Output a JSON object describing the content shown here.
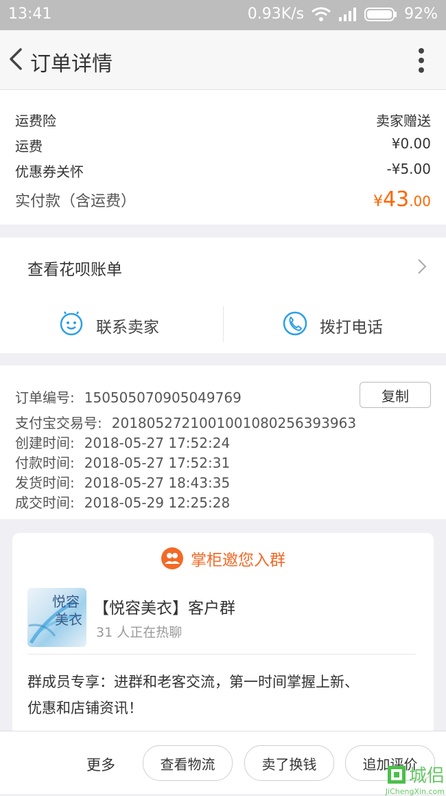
{
  "status": {
    "time": "13:41",
    "speed": "0.93K/s",
    "battery": "92%"
  },
  "header": {
    "title": "订单详情"
  },
  "fees": [
    {
      "label": "运费险",
      "value": "卖家赠送"
    },
    {
      "label": "运费",
      "value": "¥0.00"
    },
    {
      "label": "优惠券关怀",
      "value": "-¥5.00"
    }
  ],
  "paid": {
    "label": "实付款（含运费）",
    "currency": "¥",
    "amount_int": "43",
    "amount_dec": ".00"
  },
  "huabei": {
    "label": "查看花呗账单"
  },
  "contact": {
    "seller_label": "联系卖家",
    "call_label": "拨打电话"
  },
  "order_info": {
    "copy_label": "复制",
    "rows": [
      {
        "label": "订单编号:",
        "value": "150505070905049769"
      },
      {
        "label": "支付宝交易号:",
        "value": "2018052721001001080256393963"
      },
      {
        "label": "创建时间:",
        "value": "2018-05-27 17:52:24"
      },
      {
        "label": "付款时间:",
        "value": "2018-05-27 17:52:31"
      },
      {
        "label": "发货时间:",
        "value": "2018-05-27 18:43:35"
      },
      {
        "label": "成交时间:",
        "value": "2018-05-29 12:25:28"
      }
    ]
  },
  "group": {
    "invite_title": "掌柜邀您入群",
    "logo_text_1": "悦容",
    "logo_text_2": "美衣",
    "name": "【悦容美衣】客户群",
    "members": "31 人正在热聊",
    "desc_line1": "群成员专享：进群和老客交流，第一时间掌握上新、",
    "desc_line2": "优惠和店铺资讯！"
  },
  "bottom": {
    "more_label": "更多",
    "logistics_label": "查看物流",
    "sell_label": "卖了换钱",
    "review_label": "追加评价"
  },
  "watermark": {
    "text": "城侣",
    "sub": "JiChengXin.com"
  },
  "colors": {
    "accent": "#ff6600",
    "blue": "#2b9fe6",
    "group_orange": "#f26a27"
  }
}
